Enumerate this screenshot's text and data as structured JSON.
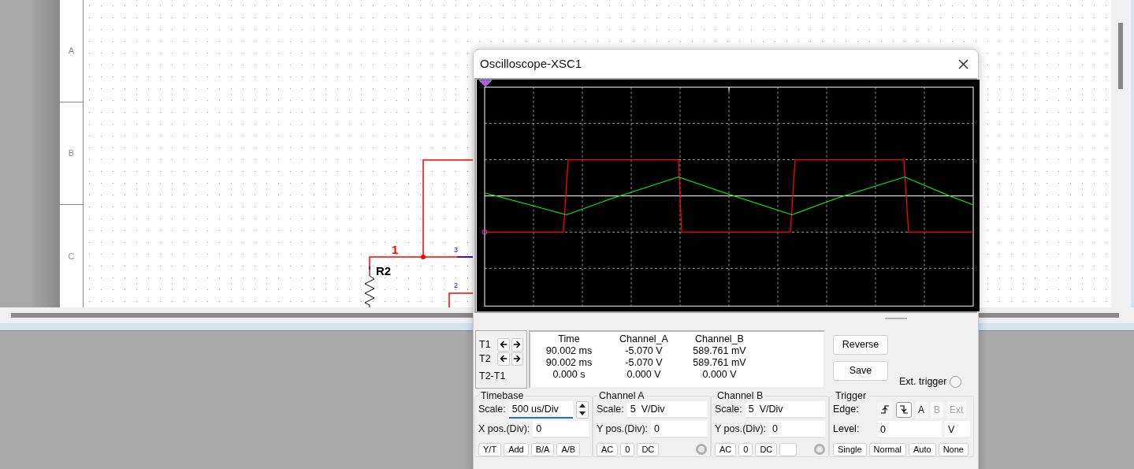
{
  "app": {
    "sheet_rows": [
      "A",
      "B",
      "C"
    ],
    "schematic": {
      "node_label": "1",
      "component_label": "R2",
      "pin_labels": [
        "3",
        "2"
      ]
    }
  },
  "scope": {
    "title": "Oscilloscope-XSC1",
    "cursors": [
      {
        "label": "T1"
      },
      {
        "label": "T2"
      }
    ],
    "cursor_diff": "T2-T1",
    "readout": {
      "columns": [
        "Time",
        "Channel_A",
        "Channel_B"
      ],
      "rows": [
        [
          "90.002 ms",
          "-5.070 V",
          "589.761 mV"
        ],
        [
          "90.002 ms",
          "-5.070 V",
          "589.761 mV"
        ],
        [
          "0.000 s",
          "0.000 V",
          "0.000 V"
        ]
      ]
    },
    "buttons": [
      "Reverse",
      "Save"
    ],
    "ext_trigger": {
      "label": "Ext. trigger",
      "selected": false
    },
    "groups": [
      {
        "kind": "timebase",
        "title": "Timebase",
        "fields": [
          {
            "label": "Scale:",
            "value": "500 us/Div",
            "kind": "spin",
            "focused": true
          },
          {
            "label": "X pos.(Div):",
            "value": "0",
            "kind": "text",
            "focused": false
          }
        ],
        "buttons": [
          {
            "kind": "text",
            "label": "Y/T"
          },
          {
            "kind": "text",
            "label": "Add"
          },
          {
            "kind": "text",
            "label": "B/A"
          },
          {
            "kind": "text",
            "label": "A/B"
          }
        ]
      },
      {
        "kind": "channel",
        "title": "Channel A",
        "fields": [
          {
            "label": "Scale:",
            "value": "5  V/Div",
            "kind": "text",
            "focused": false
          },
          {
            "label": "Y pos.(Div):",
            "value": "0",
            "kind": "text",
            "focused": false
          }
        ],
        "buttons": [
          {
            "kind": "text",
            "label": "AC"
          },
          {
            "kind": "text",
            "label": "0"
          },
          {
            "kind": "text",
            "label": "DC"
          }
        ]
      },
      {
        "kind": "channel",
        "title": "Channel B",
        "fields": [
          {
            "label": "Scale:",
            "value": "5  V/Div",
            "kind": "text",
            "focused": false
          },
          {
            "label": "Y pos.(Div):",
            "value": "0",
            "kind": "text",
            "focused": false
          }
        ],
        "buttons": [
          {
            "kind": "text",
            "label": "AC"
          },
          {
            "kind": "text",
            "label": "0"
          },
          {
            "kind": "text",
            "label": "DC"
          },
          {
            "kind": "blank"
          }
        ]
      },
      {
        "kind": "trigger",
        "title": "Trigger",
        "edge": {
          "label": "Edge:",
          "slopes": [
            {
              "kind": "rising",
              "selected": false
            },
            {
              "kind": "falling",
              "selected": true
            }
          ],
          "sources": [
            {
              "label": "A",
              "disabled": false
            },
            {
              "label": "B",
              "disabled": true
            },
            {
              "label": "Ext",
              "disabled": true
            }
          ]
        },
        "level": {
          "label": "Level:",
          "value": "0",
          "unit": "V"
        },
        "buttons": [
          {
            "kind": "text",
            "label": "Single"
          },
          {
            "kind": "text",
            "label": "Normal"
          },
          {
            "kind": "text",
            "label": "Auto"
          },
          {
            "kind": "text",
            "label": "None"
          }
        ]
      }
    ]
  }
}
